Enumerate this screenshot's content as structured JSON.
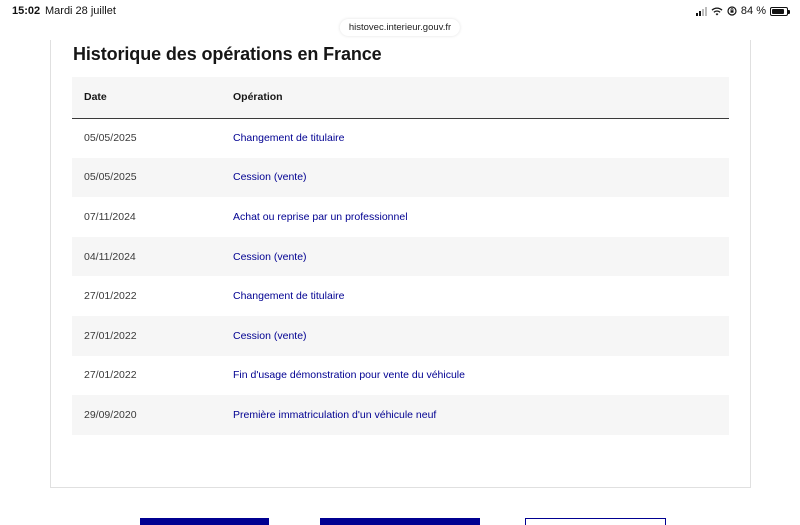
{
  "status_bar": {
    "time": "15:02",
    "date": "Mardi 28 juillet",
    "battery": "84 %",
    "battery_level": 0.84,
    "icons": [
      "cellular-signal-icon",
      "wifi-icon",
      "screen-lock-rotation-icon",
      "battery-icon"
    ]
  },
  "browser": {
    "url": "histovec.interieur.gouv.fr"
  },
  "section": {
    "title": "Historique des opérations en France"
  },
  "table": {
    "headers": {
      "date": "Date",
      "operation": "Opération"
    },
    "rows": [
      {
        "date": "05/05/2025",
        "operation": "Changement de titulaire"
      },
      {
        "date": "05/05/2025",
        "operation": "Cession (vente)"
      },
      {
        "date": "07/11/2024",
        "operation": "Achat ou reprise par un professionnel"
      },
      {
        "date": "04/11/2024",
        "operation": "Cession (vente)"
      },
      {
        "date": "27/01/2022",
        "operation": "Changement de titulaire"
      },
      {
        "date": "27/01/2022",
        "operation": "Cession (vente)"
      },
      {
        "date": "27/01/2022",
        "operation": "Fin d'usage démonstration pour vente du véhicule"
      },
      {
        "date": "29/09/2020",
        "operation": "Première immatriculation d'un véhicule neuf"
      }
    ]
  },
  "colors": {
    "accent": "#000091",
    "header_bg": "#f6f6f6",
    "stripe_bg": "#f6f6f6",
    "text": "#161616"
  }
}
